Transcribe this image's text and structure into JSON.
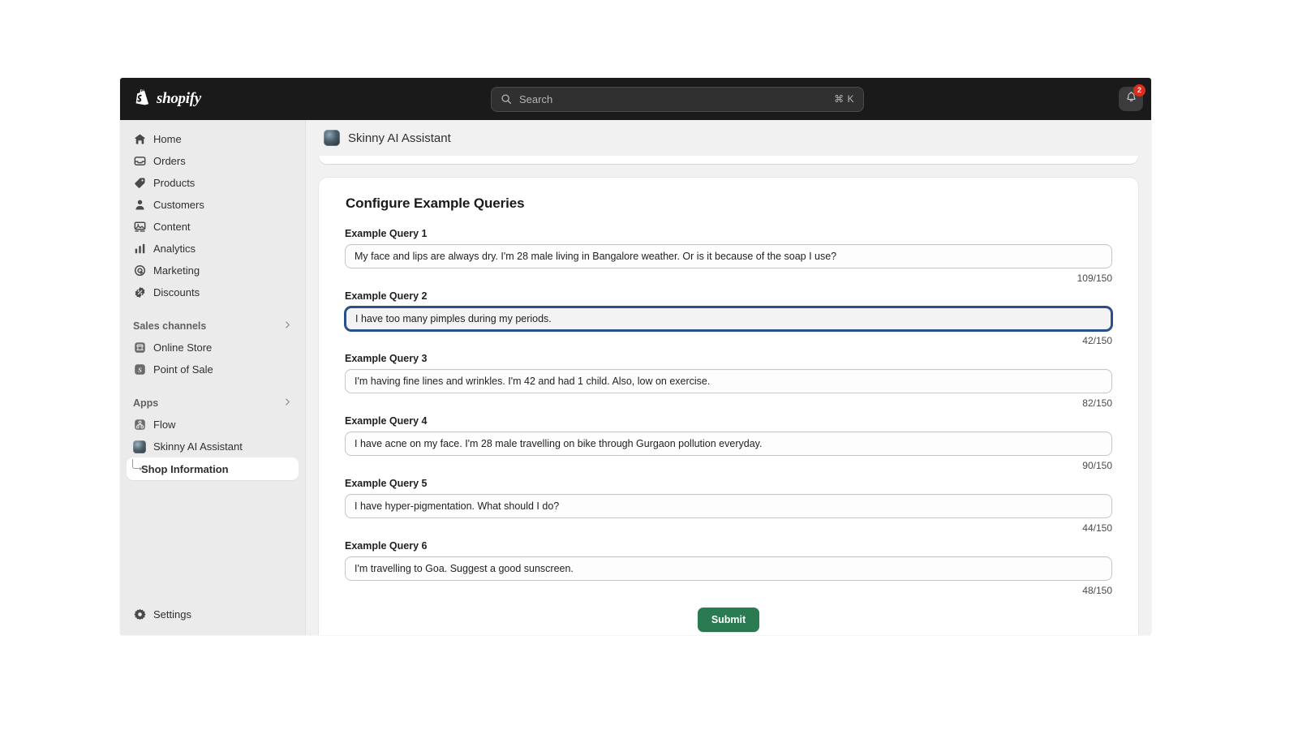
{
  "topbar": {
    "brand_name": "shopify",
    "brand_logo_icon": "shopify-bag-icon",
    "search": {
      "placeholder": "Search",
      "value": "",
      "shortcut": "⌘ K",
      "icon": "search-icon"
    },
    "notifications": {
      "icon": "bell-icon",
      "badge_count": "2"
    }
  },
  "sidebar": {
    "primary_items": [
      {
        "label": "Home",
        "icon": "home-icon"
      },
      {
        "label": "Orders",
        "icon": "orders-inbox-icon"
      },
      {
        "label": "Products",
        "icon": "product-tag-icon"
      },
      {
        "label": "Customers",
        "icon": "person-icon"
      },
      {
        "label": "Content",
        "icon": "content-image-icon"
      },
      {
        "label": "Analytics",
        "icon": "bar-chart-icon"
      },
      {
        "label": "Marketing",
        "icon": "marketing-target-icon"
      },
      {
        "label": "Discounts",
        "icon": "discount-badge-icon"
      }
    ],
    "sales_channels": {
      "label": "Sales channels",
      "chevron_icon": "chevron-right-icon",
      "items": [
        {
          "label": "Online Store",
          "icon": "storefront-icon"
        },
        {
          "label": "Point of Sale",
          "icon": "pos-icon"
        }
      ]
    },
    "apps": {
      "label": "Apps",
      "chevron_icon": "chevron-right-icon",
      "items": [
        {
          "label": "Flow",
          "icon": "flow-app-icon"
        },
        {
          "label": "Skinny AI Assistant",
          "icon": "skinny-ai-app-icon"
        }
      ],
      "sub_item": {
        "label": "Shop Information",
        "icon": "elbow-arrow-icon",
        "selected": true
      }
    },
    "settings": {
      "label": "Settings",
      "icon": "gear-icon"
    }
  },
  "main": {
    "app_header": {
      "title": "Skinny AI Assistant",
      "avatar_icon": "skinny-ai-app-icon"
    },
    "card": {
      "title": "Configure Example Queries",
      "fields": [
        {
          "label": "Example Query 1",
          "value": "My face and lips are always dry. I'm 28 male living in Bangalore weather. Or is it because of the soap I use?",
          "count": "109/150",
          "focused": false
        },
        {
          "label": "Example Query 2",
          "value": "I have too many pimples during my periods.",
          "count": "42/150",
          "focused": true
        },
        {
          "label": "Example Query 3",
          "value": "I'm having fine lines and wrinkles. I'm 42 and had 1 child. Also, low on exercise.",
          "count": "82/150",
          "focused": false
        },
        {
          "label": "Example Query 4",
          "value": "I have acne on my face. I'm 28 male travelling on bike through Gurgaon pollution everyday.",
          "count": "90/150",
          "focused": false
        },
        {
          "label": "Example Query 5",
          "value": "I have hyper-pigmentation. What should I do?",
          "count": "44/150",
          "focused": false
        },
        {
          "label": "Example Query 6",
          "value": "I'm travelling to Goa. Suggest a good sunscreen.",
          "count": "48/150",
          "focused": false
        }
      ],
      "submit_label": "Submit"
    }
  },
  "colors": {
    "topbar_bg": "#1a1a1a",
    "sidebar_bg": "#ebebeb",
    "canvas_bg": "#f1f1f1",
    "submit_green": "#2a7a52",
    "focus_blue": "#2b4f87",
    "badge_red": "#e02b1d"
  }
}
